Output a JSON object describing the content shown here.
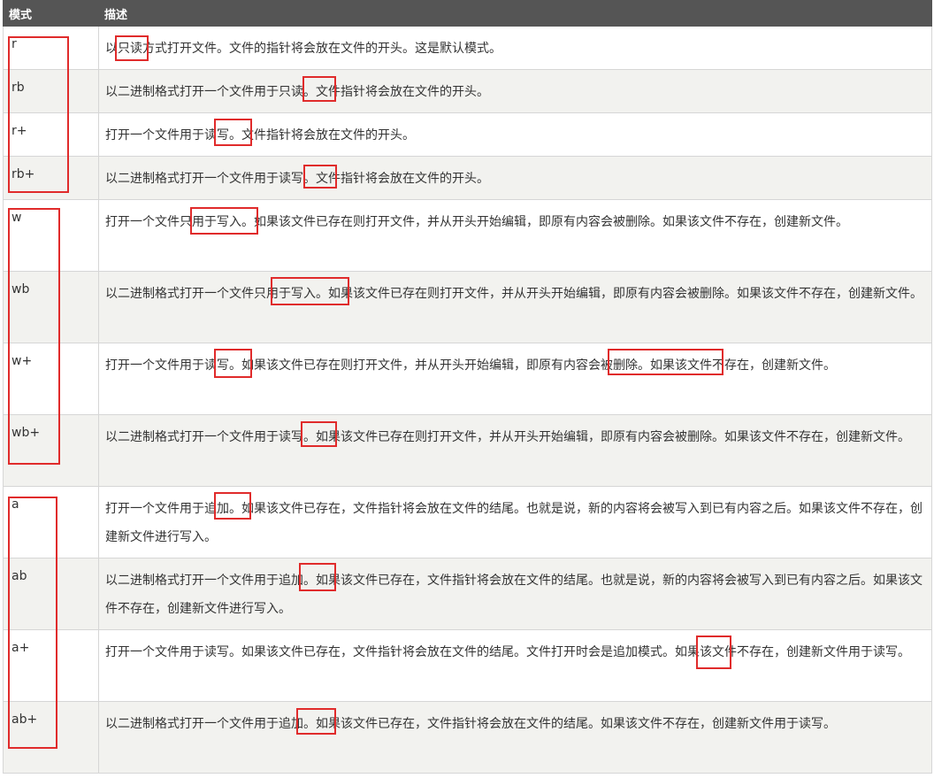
{
  "table": {
    "headers": [
      "模式",
      "描述"
    ],
    "rows": [
      {
        "mode": "r",
        "desc": "以只读方式打开文件。文件的指针将会放在文件的开头。这是默认模式。"
      },
      {
        "mode": "rb",
        "desc": "以二进制格式打开一个文件用于只读。文件指针将会放在文件的开头。"
      },
      {
        "mode": "r+",
        "desc": "打开一个文件用于读写。文件指针将会放在文件的开头。"
      },
      {
        "mode": "rb+",
        "desc": "以二进制格式打开一个文件用于读写。文件指针将会放在文件的开头。"
      },
      {
        "mode": "w",
        "desc": "打开一个文件只用于写入。如果该文件已存在则打开文件，并从开头开始编辑，即原有内容会被删除。如果该文件不存在，创建新文件。"
      },
      {
        "mode": "wb",
        "desc": "以二进制格式打开一个文件只用于写入。如果该文件已存在则打开文件，并从开头开始编辑，即原有内容会被删除。如果该文件不存在，创建新文件。"
      },
      {
        "mode": "w+",
        "desc": "打开一个文件用于读写。如果该文件已存在则打开文件，并从开头开始编辑，即原有内容会被删除。如果该文件不存在，创建新文件。"
      },
      {
        "mode": "wb+",
        "desc": "以二进制格式打开一个文件用于读写。如果该文件已存在则打开文件，并从开头开始编辑，即原有内容会被删除。如果该文件不存在，创建新文件。"
      },
      {
        "mode": "a",
        "desc": "打开一个文件用于追加。如果该文件已存在，文件指针将会放在文件的结尾。也就是说，新的内容将会被写入到已有内容之后。如果该文件不存在，创建新文件进行写入。"
      },
      {
        "mode": "ab",
        "desc": "以二进制格式打开一个文件用于追加。如果该文件已存在，文件指针将会放在文件的结尾。也就是说，新的内容将会被写入到已有内容之后。如果该文件不存在，创建新文件进行写入。"
      },
      {
        "mode": "a+",
        "desc": "打开一个文件用于读写。如果该文件已存在，文件指针将会放在文件的结尾。文件打开时会是追加模式。如果该文件不存在，创建新文件用于读写。"
      },
      {
        "mode": "ab+",
        "desc": "以二进制格式打开一个文件用于追加。如果该文件已存在，文件指针将会放在文件的结尾。如果该文件不存在，创建新文件用于读写。"
      }
    ]
  },
  "annotation_color": "#e02b2b"
}
